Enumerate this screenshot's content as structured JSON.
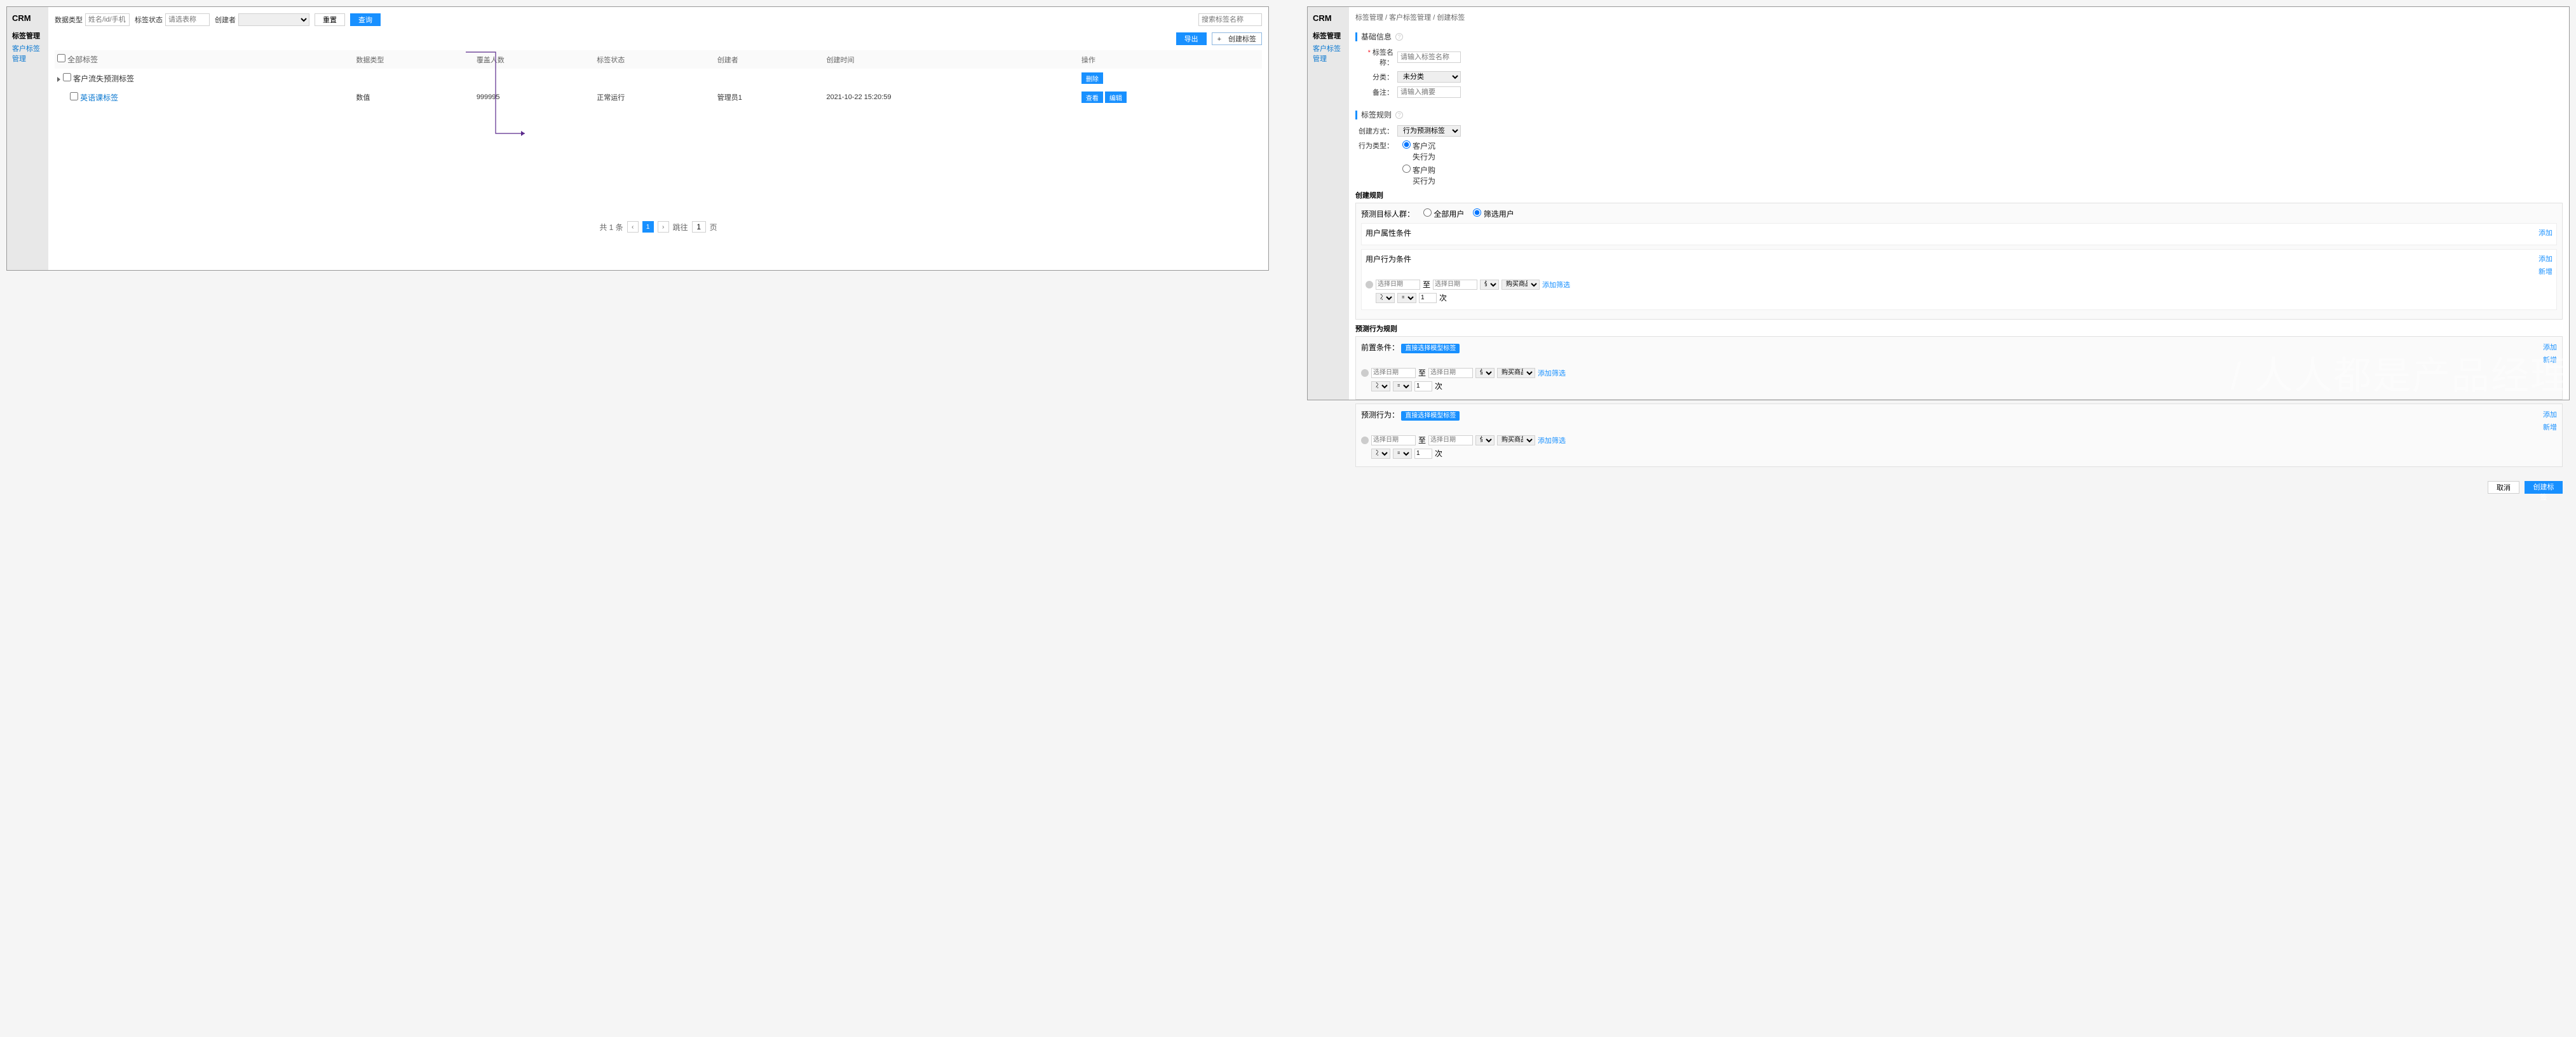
{
  "sidebar": {
    "brand": "CRM",
    "menu_title": "标签管理",
    "menu_link": "客户标签管理"
  },
  "left": {
    "filters": {
      "data_type_label": "数据类型",
      "data_type_placeholder": "姓名/id/手机",
      "tag_status_label": "标签状态",
      "tag_status_placeholder": "请选表称",
      "creator_label": "创建者",
      "reset_btn": "重置",
      "query_btn": "查询",
      "search_placeholder": "搜索标签名称"
    },
    "actions": {
      "export_btn": "导出",
      "create_btn": "+　创建标签"
    },
    "table": {
      "headers": [
        "全部标签",
        "数据类型",
        "覆盖人数",
        "标签状态",
        "创建者",
        "创建时间",
        "操作"
      ],
      "parent_row": "客户流失预测标签",
      "child": {
        "name": "英语课标签",
        "data_type": "数值",
        "cover": "999995",
        "status": "正常运行",
        "creator": "管理员1",
        "created": "2021-10-22 15:20:59"
      },
      "btn_delete": "删除",
      "btn_view": "查看",
      "btn_edit": "编辑"
    },
    "pagination": {
      "total": "共 1 条",
      "jump": "跳往",
      "page_val": "1",
      "page_suffix": "页"
    }
  },
  "right": {
    "breadcrumb": "标签管理 / 客户标签管理 / 创建标签",
    "basic": {
      "section_title": "基础信息",
      "name_label": "标签名称：",
      "name_placeholder": "请输入标签名称",
      "category_label": "分类：",
      "category_value": "未分类",
      "remark_label": "备注：",
      "remark_placeholder": "请输入摘要"
    },
    "rules": {
      "section_title": "标签规则",
      "create_mode_label": "创建方式：",
      "create_mode_value": "行为预测标签",
      "behavior_type_label": "行为类型：",
      "behavior_opt1": "客户沉失行为",
      "behavior_opt2": "客户购买行为",
      "create_rule_label": "创建规则",
      "target_label": "预测目标人群：",
      "target_opt1": "全部用户",
      "target_opt2": "筛选用户",
      "user_attr_title": "用户属性条件",
      "user_behavior_title": "用户行为条件",
      "date_from_placeholder": "选择日期",
      "to": "至",
      "date_to_placeholder": "选择日期",
      "did": "做过",
      "action": "购买商品",
      "add_filter": "添加筛选",
      "count_label": "次数",
      "count_val": "1",
      "count_suffix": "次",
      "predict_rule_title": "预测行为规则",
      "precond_label": "前置条件：",
      "use_model_tag": "直接选择模型标签",
      "predict_behavior_label": "预测行为：",
      "add": "添加",
      "new": "新增"
    },
    "footer": {
      "cancel_btn": "取消",
      "confirm_btn": "创建标签"
    }
  },
  "watermark": "/ 人人都是产品经理"
}
